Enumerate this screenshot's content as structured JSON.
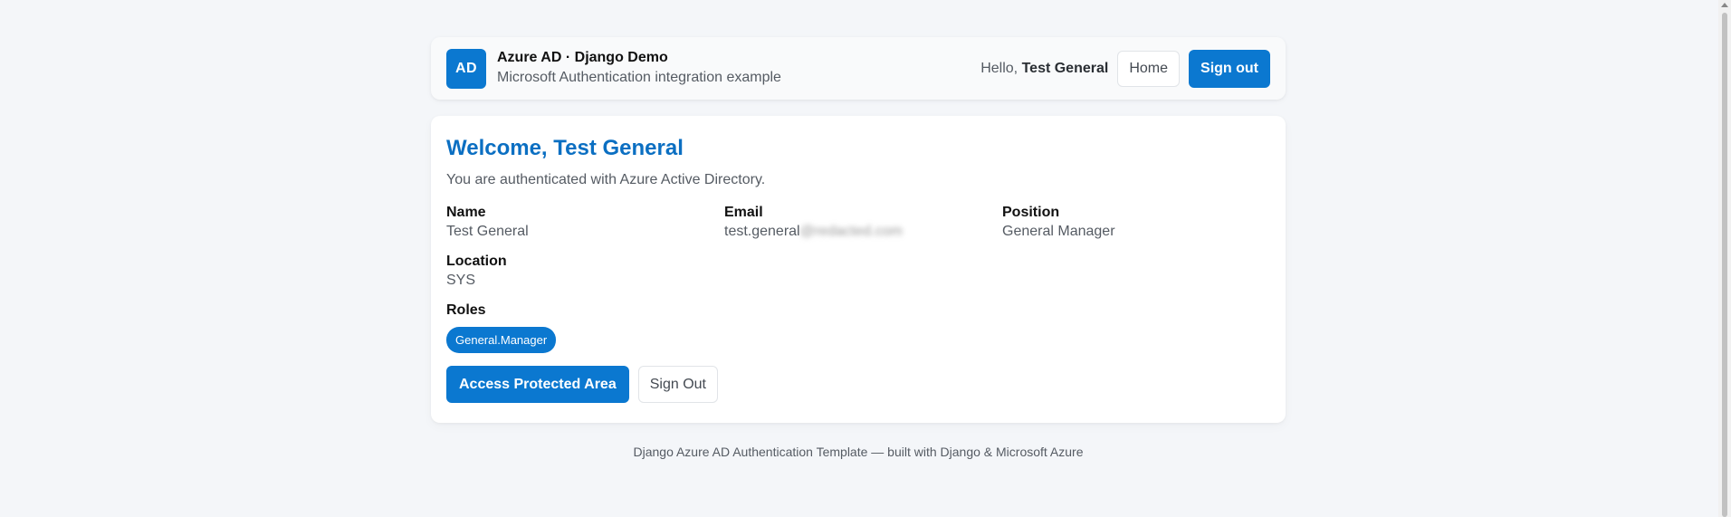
{
  "header": {
    "logo_text": "AD",
    "title": "Azure AD · Django Demo",
    "subtitle": "Microsoft Authentication integration example",
    "hello_prefix": "Hello,",
    "user_name": "Test General",
    "home_label": "Home",
    "signout_label": "Sign out"
  },
  "main": {
    "welcome": "Welcome, Test General",
    "subtitle": "You are authenticated with Azure Active Directory.",
    "fields": {
      "name_label": "Name",
      "name_value": "Test General",
      "email_label": "Email",
      "email_value": "test.general",
      "email_hidden": "@redacted.com",
      "position_label": "Position",
      "position_value": "General Manager",
      "location_label": "Location",
      "location_value": "SYS"
    },
    "roles_label": "Roles",
    "roles": [
      "General.Manager"
    ],
    "access_button": "Access Protected Area",
    "signout_button": "Sign Out"
  },
  "footer": {
    "text": "Django Azure AD Authentication Template — built with Django & Microsoft Azure"
  },
  "colors": {
    "primary": "#0b78d0",
    "heading": "#0b6fc2",
    "background": "#f4f6f9"
  }
}
